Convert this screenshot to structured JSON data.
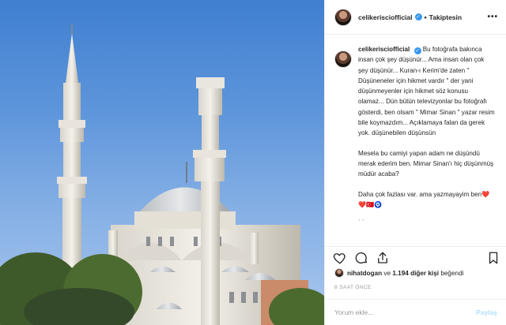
{
  "post": {
    "username": "celikerisciofficial",
    "follow_status": "Takiptesin",
    "more_label": "•••",
    "verified_glyph": "✓"
  },
  "caption": {
    "username": "celikerisciofficial",
    "paragraph1": "Bu fotoğrafa bakınca insan çok şey düşünür... Ama insan olan çok şey düşünür... Kuran-ı Kerim'de zaten \" Düşüneneler için hikmet vardır \" der yani düşünmeyenler için hikmet söz konusu olamaz... Dün bütün televizyonlar bu fotoğrafı gösterdi, ben olsam \" Mimar Sinan \" yazar resim bile koymazdım... Açıklamaya falan da gerek yok. düşünebilen düşünsün",
    "paragraph2": "Mesela bu camiyi yapan adam ne düşündü merak ederim ben. Mimar Sinan'ı hiç düşünmüş müdür acaba?",
    "paragraph3": "Daha çok fazlası var. ama yazmayayim ben❤️❤️🇹🇷🧿",
    "more_indicator": "- -"
  },
  "actions": {
    "like_icon": "heart-icon",
    "comment_icon": "comment-icon",
    "share_icon": "share-icon",
    "save_icon": "bookmark-icon"
  },
  "likes": {
    "first_liker": "nihatdogan",
    "connector": " ve ",
    "others": "1.194 diğer kişi",
    "suffix": " beğendi"
  },
  "timestamp": "8 SAAT ÖNCE",
  "composer": {
    "placeholder": "Yorum ekle...",
    "post_label": "Paylaş"
  },
  "colors": {
    "verified": "#3897f0",
    "post_disabled": "#b2dffc",
    "text": "#262626",
    "muted": "#999999"
  }
}
